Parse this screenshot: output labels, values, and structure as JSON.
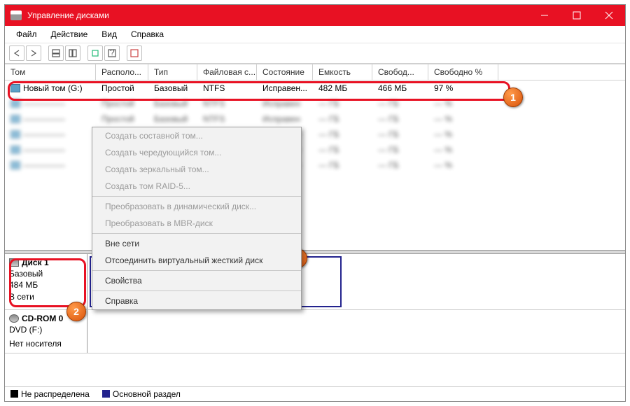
{
  "window": {
    "title": "Управление дисками"
  },
  "menubar": {
    "items": [
      "Файл",
      "Действие",
      "Вид",
      "Справка"
    ]
  },
  "grid": {
    "headers": [
      "Том",
      "Располо...",
      "Тип",
      "Файловая с...",
      "Состояние",
      "Емкость",
      "Свобод...",
      "Свободно %"
    ],
    "row0": {
      "volume": "Новый том (G:)",
      "layout": "Простой",
      "type": "Базовый",
      "fs": "NTFS",
      "status": "Исправен...",
      "capacity": "482 МБ",
      "free": "466 МБ",
      "free_pct": "97 %"
    }
  },
  "context_menu": {
    "items": [
      "Создать составной том...",
      "Создать чередующийся том...",
      "Создать зеркальный том...",
      "Создать том RAID-5...",
      "Преобразовать в динамический диск...",
      "Преобразовать в MBR-диск",
      "Вне сети",
      "Отсоединить виртуальный жесткий диск",
      "Свойства",
      "Справка"
    ]
  },
  "lower": {
    "disk1": {
      "name": "Диск 1",
      "type": "Базовый",
      "size": "484 МБ",
      "status": "В сети"
    },
    "cdrom": {
      "name": "CD-ROM 0",
      "drive": "DVD (F:)",
      "status": "Нет носителя"
    }
  },
  "legend": {
    "unalloc": "Не распределена",
    "primary": "Основной раздел"
  }
}
